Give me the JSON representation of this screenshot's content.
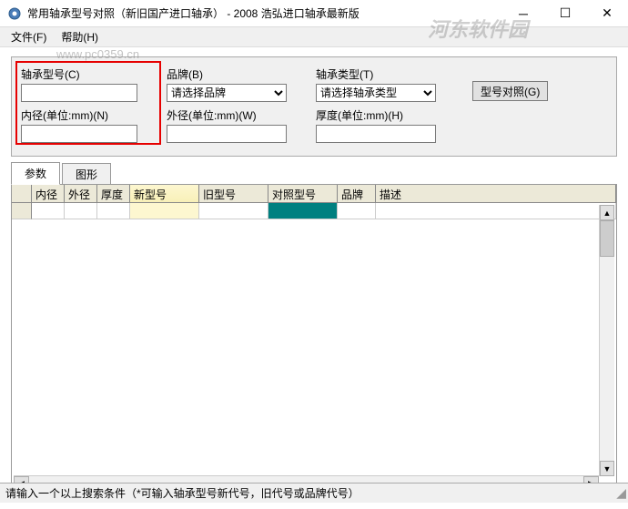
{
  "window": {
    "title": "常用轴承型号对照（新旧国产进口轴承） - 2008 浩弘进口轴承最新版"
  },
  "menu": {
    "file": "文件(F)",
    "help": "帮助(H)"
  },
  "watermark": {
    "main": "河东软件园",
    "url": "www.pc0359.cn"
  },
  "search": {
    "model_label": "轴承型号(C)",
    "model_value": "",
    "brand_label": "品牌(B)",
    "brand_selected": "请选择品牌",
    "type_label": "轴承类型(T)",
    "type_selected": "请选择轴承类型",
    "inner_label": "内径(单位:mm)(N)",
    "inner_value": "",
    "outer_label": "外径(单位:mm)(W)",
    "outer_value": "",
    "thick_label": "厚度(单位:mm)(H)",
    "thick_value": "",
    "compare_btn": "型号对照(G)"
  },
  "tabs": {
    "params": "参数",
    "graphic": "图形"
  },
  "grid": {
    "headers": {
      "inner": "内径",
      "outer": "外径",
      "thick": "厚度",
      "new_model": "新型号",
      "old_model": "旧型号",
      "ref_model": "对照型号",
      "brand": "品牌",
      "desc": "描述"
    }
  },
  "status": {
    "text": "请输入一个以上搜索条件（*可输入轴承型号新代号，旧代号或品牌代号）"
  }
}
